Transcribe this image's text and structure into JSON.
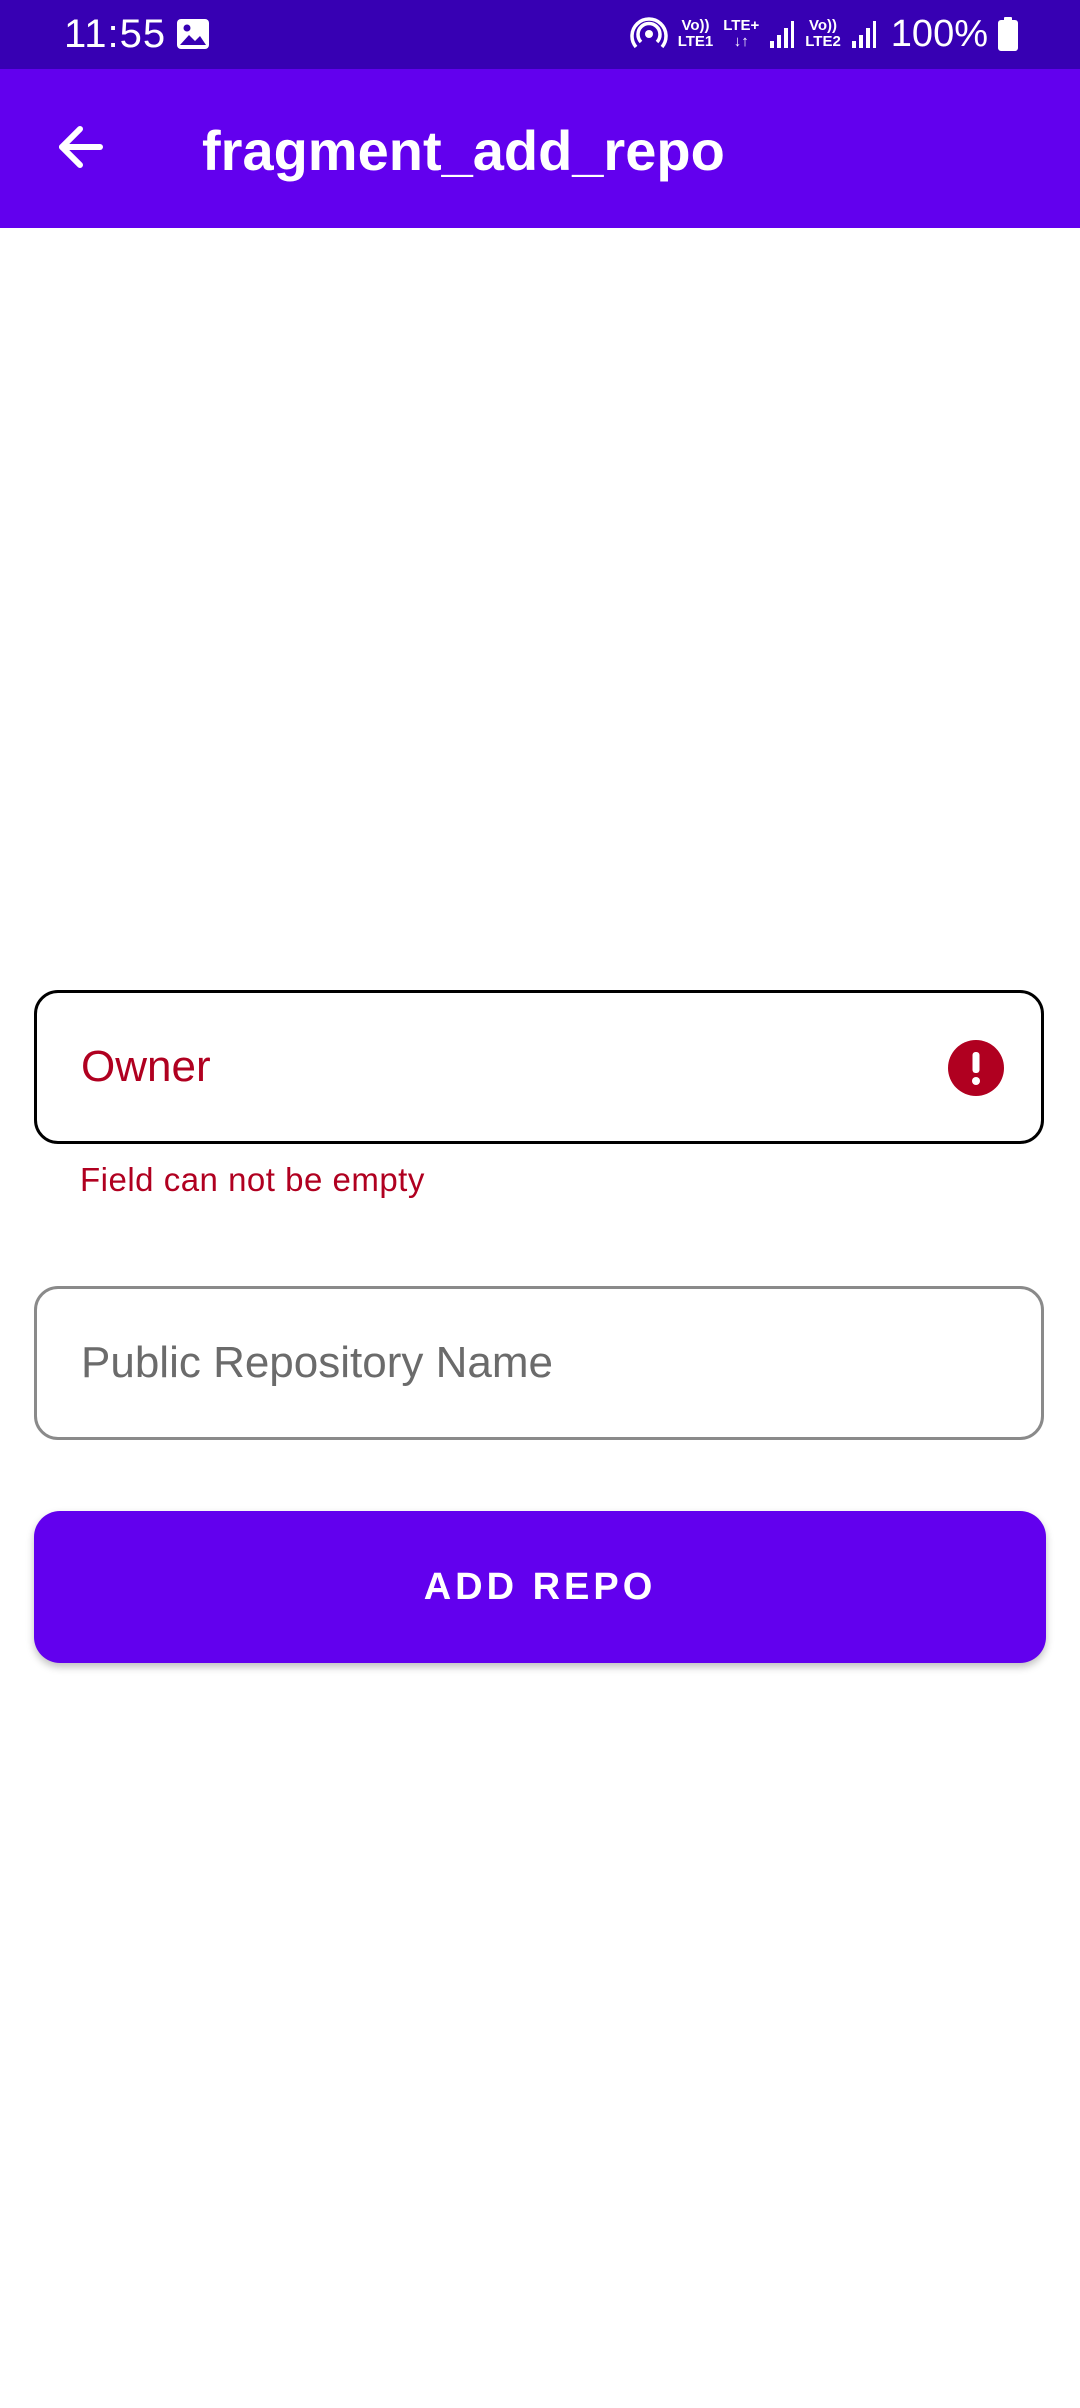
{
  "status_bar": {
    "time": "11:55",
    "sim1_top": "Vo))",
    "sim1_bottom": "LTE1",
    "network_type": "LTE+",
    "sim2_top": "Vo))",
    "sim2_bottom": "LTE2",
    "battery": "100%"
  },
  "app_bar": {
    "title": "fragment_add_repo",
    "back_icon": "arrow-back-icon"
  },
  "form": {
    "owner": {
      "label": "Owner",
      "value": "",
      "error": "Field can not be empty",
      "error_icon": "error-icon"
    },
    "repo_name": {
      "placeholder": "Public Repository Name",
      "value": ""
    },
    "submit_label": "ADD REPO"
  },
  "colors": {
    "status_bar": "#3700b3",
    "primary": "#6200ee",
    "error": "#b00020",
    "outline": "#8a8a8a"
  }
}
